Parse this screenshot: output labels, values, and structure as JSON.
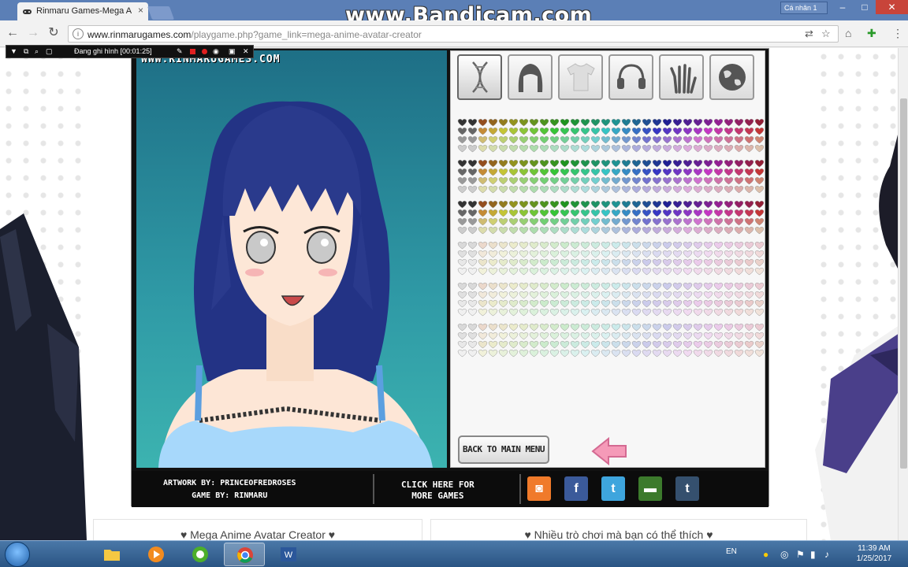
{
  "browser": {
    "tab_title": "Rinmaru Games-Mega A",
    "tab_close": "×",
    "user_label": "Cá nhân 1",
    "url_host": "www.rinmarugames.com",
    "url_path": "/playgame.php?game_link=mega-anime-avatar-creator",
    "overlay_watermark": "www.Bandicam.com"
  },
  "recorder": {
    "status": "Đang ghi hình [00:01:25]"
  },
  "game": {
    "site_watermark": "WWW.RINMARUGAMES.COM",
    "back_button": "BACK TO MAIN MENU",
    "credit_artwork": "ARTWORK BY: PRINCEOFREDROSES",
    "credit_game": "GAME BY: RINMARU",
    "more_games_line1": "CLICK HERE FOR",
    "more_games_line2": "MORE GAMES",
    "category_icons": [
      "dna-icon",
      "hair-icon",
      "shirt-icon",
      "headphones-icon",
      "hand-icon",
      "globe-icon"
    ],
    "social": [
      {
        "name": "camera-share",
        "label": "",
        "color": "#f07a2a"
      },
      {
        "name": "facebook",
        "label": "f",
        "color": "#3b5a9a"
      },
      {
        "name": "twitter",
        "label": "t",
        "color": "#3ea5dd"
      },
      {
        "name": "green-share",
        "label": "",
        "color": "#3c7a2c"
      },
      {
        "name": "tumblr",
        "label": "t",
        "color": "#35506e"
      }
    ],
    "hair_color": "#2a3a8c",
    "top_color": "#9fd6ff"
  },
  "below": {
    "left_heading": "♥ Mega Anime Avatar Creator ♥",
    "right_heading": "♥ Nhiều trò chơi mà bạn có thể thích ♥"
  },
  "taskbar": {
    "language": "EN",
    "time": "11:39 AM",
    "date": "1/25/2017"
  }
}
